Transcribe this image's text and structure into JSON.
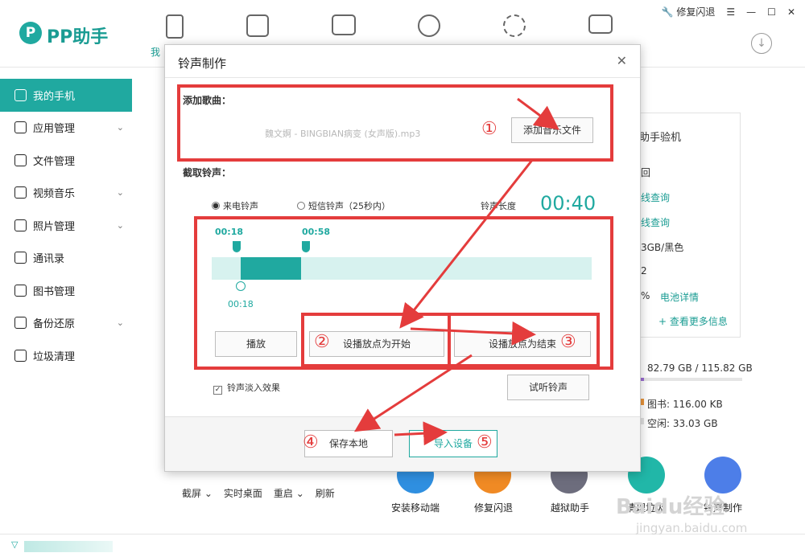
{
  "app": {
    "logo_text": "PP助手",
    "nav_active_label": "我",
    "window_controls": {
      "repair_label": "修复闪退"
    }
  },
  "sidebar": {
    "items": [
      {
        "label": "我的手机",
        "has_arrow": false
      },
      {
        "label": "应用管理",
        "has_arrow": true
      },
      {
        "label": "文件管理",
        "has_arrow": false
      },
      {
        "label": "视频音乐",
        "has_arrow": true
      },
      {
        "label": "照片管理",
        "has_arrow": true
      },
      {
        "label": "通讯录",
        "has_arrow": false
      },
      {
        "label": "图书管理",
        "has_arrow": false
      },
      {
        "label": "备份还原",
        "has_arrow": true
      },
      {
        "label": "垃圾清理",
        "has_arrow": false
      }
    ]
  },
  "info_panel": {
    "verify_title": "助手验机",
    "row1": "回",
    "row2": "线查询",
    "row3": "线查询",
    "row4": "3GB/黑色",
    "row5": "2",
    "row6_pct": "%",
    "battery_link": "电池详情",
    "more_link": "+ 查看更多信息",
    "storage": "82.79 GB / 115.82 GB",
    "books": "图书: 116.00 KB",
    "free": "空闲: 33.03 GB"
  },
  "bottom_bar": {
    "screenshot": "截屏",
    "live_desktop": "实时桌面",
    "restart": "重启",
    "refresh": "刷新",
    "tools": [
      {
        "label": "安装移动端"
      },
      {
        "label": "修复闪退"
      },
      {
        "label": "越狱助手"
      },
      {
        "label": "清理垃圾"
      },
      {
        "label": "铃声制作"
      }
    ]
  },
  "dialog": {
    "title": "铃声制作",
    "add_song_label": "添加歌曲：",
    "song_file": "魏文婀 - BINGBIAN病变 (女声版).mp3",
    "add_file_button": "添加音乐文件",
    "cut_label": "截取铃声：",
    "radio_incoming": "来电铃声",
    "radio_sms": "短信铃声（25秒内）",
    "length_label": "铃声长度",
    "length_value": "00:40",
    "start_marker": "00:18",
    "end_marker": "00:58",
    "play_marker": "00:18",
    "play_button": "播放",
    "set_start_button": "设播放点为开始",
    "set_end_button": "设播放点为结束",
    "fade_label": "铃声淡入效果",
    "preview_button": "试听铃声",
    "save_local_button": "保存本地",
    "import_button": "导入设备",
    "selection": {
      "start_fraction": 0.077,
      "end_fraction": 0.236
    }
  },
  "annotations": {
    "numbers": [
      "①",
      "②",
      "③",
      "④",
      "⑤"
    ],
    "color": "#e43c3c"
  },
  "watermark": {
    "line1": "Baidu经验",
    "line2": "jingyan.baidu.com"
  }
}
